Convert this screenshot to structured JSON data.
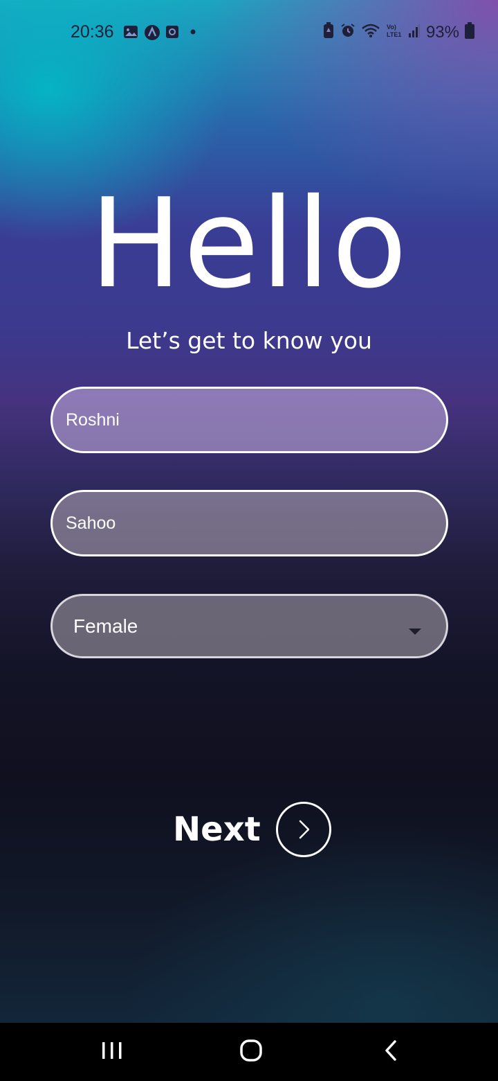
{
  "status_bar": {
    "time": "20:36",
    "battery_percent": "93%",
    "left_icons": [
      "gallery-icon",
      "app-a-icon",
      "app-square-icon",
      "dot-icon"
    ],
    "right_icons": [
      "battery-saver-icon",
      "alarm-icon",
      "wifi-icon",
      "volte-icon",
      "signal-icon",
      "battery-icon"
    ]
  },
  "header": {
    "title": "Hello",
    "subtitle": "Let’s get to know you"
  },
  "form": {
    "first_name": {
      "value": "Roshni"
    },
    "last_name": {
      "value": "Sahoo"
    },
    "gender": {
      "selected": "Female"
    }
  },
  "next_button": {
    "label": "Next",
    "icon": "chevron-right-icon"
  },
  "nav_bar": {
    "icons": [
      "recents-icon",
      "home-icon",
      "back-icon"
    ]
  },
  "colors": {
    "text": "#ffffff",
    "status_text": "#1d2038",
    "nav_background": "#000000"
  }
}
